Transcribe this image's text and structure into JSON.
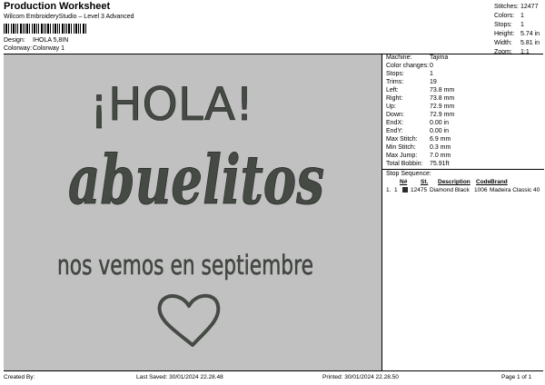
{
  "header": {
    "title": "Production Worksheet",
    "subtitle": "Wilcom EmbroideryStudio – Level 3 Advanced",
    "design_label": "Design:",
    "design_value": "IHOLA 5,8IN",
    "colorway_label": "Colorway:",
    "colorway_value": "Colorway 1"
  },
  "summary": [
    {
      "label": "Stitches:",
      "value": "12477"
    },
    {
      "label": "Colors:",
      "value": "1"
    },
    {
      "label": "Stops:",
      "value": "1"
    },
    {
      "label": "Height:",
      "value": "5.74 in"
    },
    {
      "label": "Width:",
      "value": "5.81 in"
    },
    {
      "label": "Zoom:",
      "value": "1:1"
    }
  ],
  "design": {
    "line1": "¡HOLA!",
    "line2": "abuelitos",
    "line3": "nos vemos en septiembre",
    "thread_color": "#454a44",
    "canvas_color": "#c1c1c1"
  },
  "machine_stats": [
    {
      "label": "Machine:",
      "value": "Tajima"
    },
    {
      "label": "Color changes:",
      "value": "0"
    },
    {
      "label": "Stops:",
      "value": "1"
    },
    {
      "label": "Trims:",
      "value": "19"
    },
    {
      "label": "Left:",
      "value": "73.8 mm"
    },
    {
      "label": "Right:",
      "value": "73.8 mm"
    },
    {
      "label": "Up:",
      "value": "72.9 mm"
    },
    {
      "label": "Down:",
      "value": "72.9 mm"
    },
    {
      "label": "EndX:",
      "value": "0.00 in"
    },
    {
      "label": "EndY:",
      "value": "0.00 in"
    },
    {
      "label": "Max Stitch:",
      "value": "6.9 mm"
    },
    {
      "label": "Min Stitch:",
      "value": "0.3 mm"
    },
    {
      "label": "Max Jump:",
      "value": "7.0 mm"
    },
    {
      "label": "Total Bobbin:",
      "value": "75.91ft"
    }
  ],
  "stop_sequence": {
    "title": "Stop Sequence:",
    "headers": {
      "n": "N#",
      "st": "St.",
      "desc": "Description",
      "code": "Code",
      "brand": "Brand"
    },
    "rows": [
      {
        "stop": "1.",
        "n": "1",
        "st": "12475",
        "desc": "Diamond Black",
        "code": "1006",
        "brand": "Madeira Classic 40"
      }
    ]
  },
  "footer": {
    "created_by": "Created By:",
    "last_saved": "Last Saved: 30/01/2024 22.28.48",
    "printed": "Printed: 30/01/2024 22.28.50",
    "page": "Page 1 of 1"
  }
}
